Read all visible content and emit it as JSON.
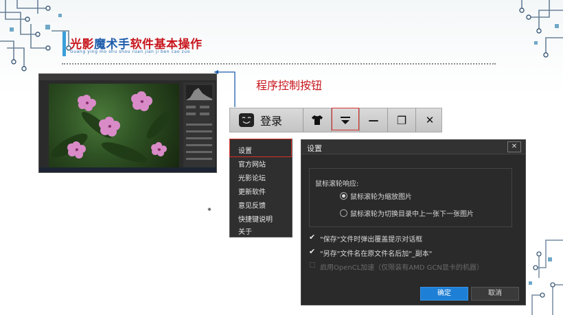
{
  "header": {
    "title_part1": "光影",
    "title_part2": "魔术手",
    "title_part3": "软件",
    "title_part4": "基本操作",
    "pinyin": "Guang ying mo shu shou ruan jian ji ben cao zuo"
  },
  "callout": {
    "label": "程序控制按钮"
  },
  "toolbar": {
    "login_label": "登录",
    "skin_icon": "tshirt-icon",
    "menu_icon": "dropdown-menu-icon",
    "minimize_glyph": "—",
    "restore_glyph": "❐",
    "close_glyph": "✕"
  },
  "menu": {
    "items": [
      "设置",
      "官方网站",
      "光影论坛",
      "更新软件",
      "意见反馈",
      "快捷键说明",
      "关于"
    ]
  },
  "dialog": {
    "title": "设置",
    "close_glyph": "✕",
    "wheel_label": "鼠标滚轮响应:",
    "radio_zoom": "鼠标滚轮为缩放图片",
    "radio_switch": "鼠标滚轮为切换目录中上一张下一张图片",
    "check_save": "\"保存\"文件时弹出覆盖提示对话框",
    "check_saveas": "\"另存\"文件名在原文件名后加\"_副本\"",
    "check_opencl": "启用OpenCL加速（仅限装有AMD GCN显卡的机器）",
    "ok_label": "确定",
    "cancel_label": "取消"
  },
  "colors": {
    "accent_red": "#c8161d",
    "accent_blue": "#1d5cab",
    "ok_button": "#1e7fd6"
  }
}
